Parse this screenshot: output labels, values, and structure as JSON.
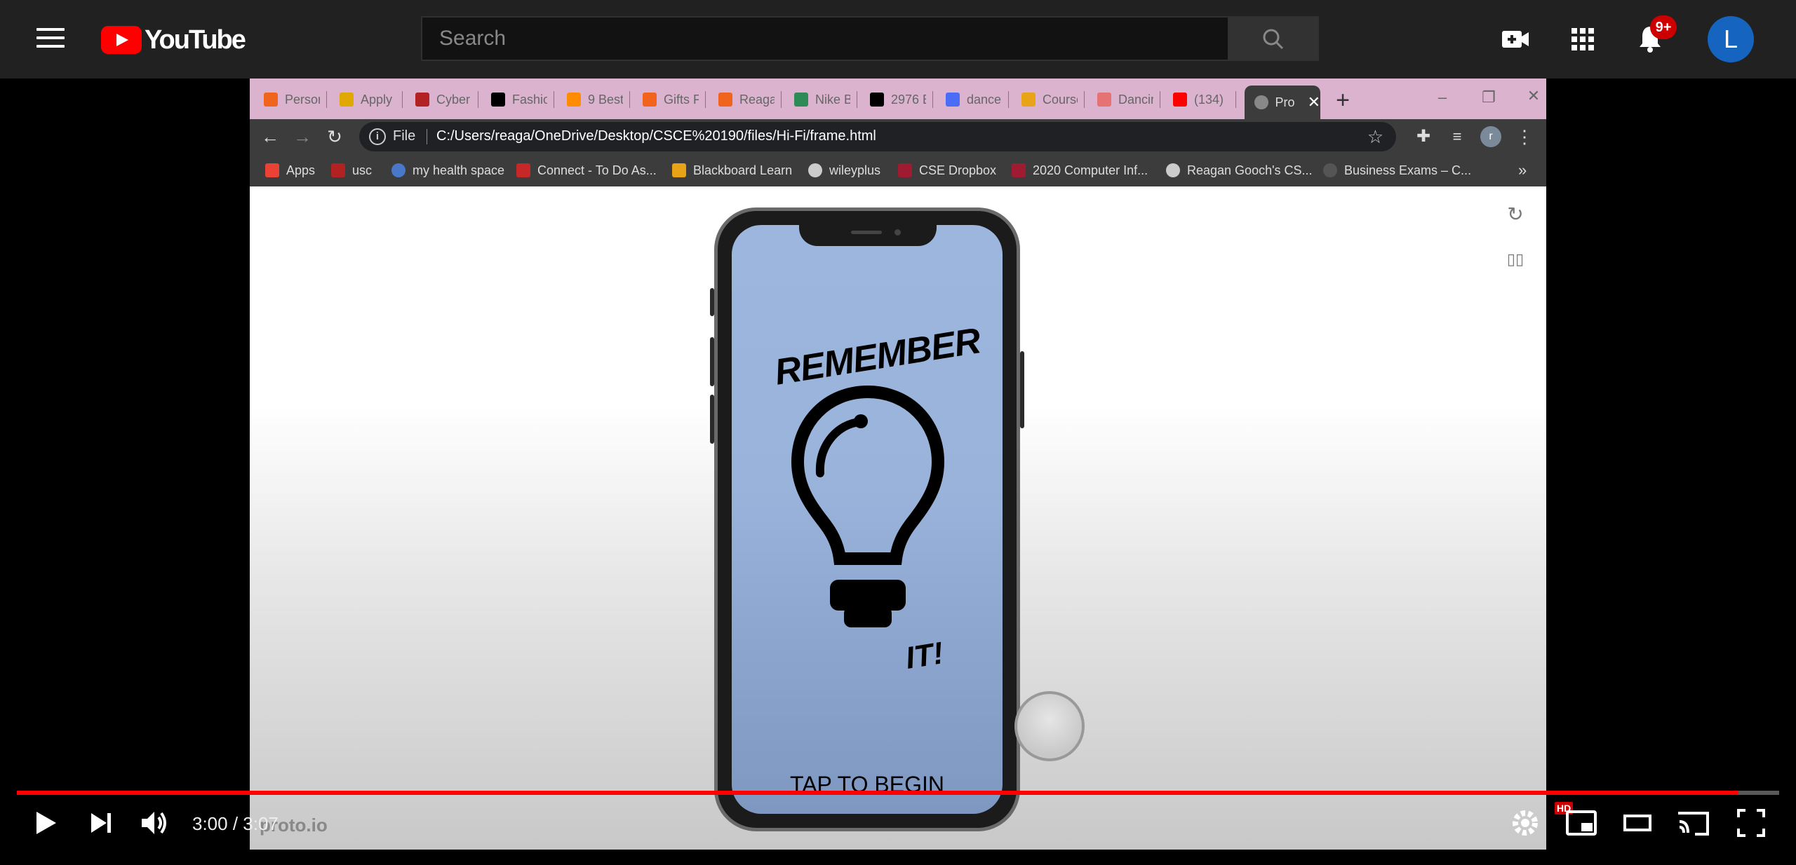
{
  "masthead": {
    "logo_text": "YouTube",
    "search_placeholder": "Search",
    "notification_count": "9+",
    "avatar_letter": "L"
  },
  "browser": {
    "tabs": [
      {
        "title": "Person",
        "favicon": "etsy-icon",
        "color": "#f1641e"
      },
      {
        "title": "Apply",
        "favicon": "coin-icon",
        "color": "#e0a800"
      },
      {
        "title": "Cyber",
        "favicon": "flag-icon",
        "color": "#b22222"
      },
      {
        "title": "Fashio",
        "favicon": "brand-icon",
        "color": "#000000"
      },
      {
        "title": "9 Best",
        "favicon": "star-icon",
        "color": "#ff8c00"
      },
      {
        "title": "Gifts F",
        "favicon": "etsy-icon",
        "color": "#f1641e"
      },
      {
        "title": "Reaga",
        "favicon": "etsy-icon",
        "color": "#f1641e"
      },
      {
        "title": "Nike B",
        "favicon": "x-icon",
        "color": "#2e8b57"
      },
      {
        "title": "2976 B",
        "favicon": "plus-icon",
        "color": "#000000"
      },
      {
        "title": "dance",
        "favicon": "q-icon",
        "color": "#4a6cf7"
      },
      {
        "title": "Course",
        "favicon": "pencil-icon",
        "color": "#e8a317"
      },
      {
        "title": "Dancir",
        "favicon": "dance-icon",
        "color": "#e57373"
      },
      {
        "title": "(134)",
        "favicon": "youtube-icon",
        "color": "#ff0000"
      }
    ],
    "active_tab": {
      "title": "Pro",
      "close": "✕"
    },
    "new_tab": "+",
    "address": {
      "scheme_label": "File",
      "url": "C:/Users/reaga/OneDrive/Desktop/CSCE%20190/files/Hi-Fi/frame.html"
    },
    "bookmarks": [
      {
        "label": "Apps",
        "icon": "apps-grid-icon",
        "color": "#ea4335"
      },
      {
        "label": "usc",
        "icon": "flag-icon",
        "color": "#b22222"
      },
      {
        "label": "my health space",
        "icon": "globe-icon",
        "color": "#4a78c8"
      },
      {
        "label": "Connect - To Do As...",
        "icon": "connect-icon",
        "color": "#c62828"
      },
      {
        "label": "Blackboard Learn",
        "icon": "pencil-icon",
        "color": "#e8a317"
      },
      {
        "label": "wileyplus",
        "icon": "globe-icon",
        "color": "#cccccc"
      },
      {
        "label": "CSE Dropbox",
        "icon": "usc-icon",
        "color": "#9e1b32"
      },
      {
        "label": "2020 Computer Inf...",
        "icon": "usc-icon",
        "color": "#9e1b32"
      },
      {
        "label": "Reagan Gooch's CS...",
        "icon": "globe-icon",
        "color": "#cccccc"
      },
      {
        "label": "Business Exams – C...",
        "icon": "shield-icon",
        "color": "#555555"
      }
    ],
    "bookmarks_more": "»"
  },
  "prototype": {
    "title_top": "REMEMBER",
    "title_bottom": "IT!",
    "cta": "TAP TO BEGIN",
    "brand": "proto.io"
  },
  "player": {
    "time": "3:00 / 3:07",
    "progress": 0.977,
    "hd_label": "HD"
  },
  "colors": {
    "youtube_red": "#ff0000",
    "masthead_bg": "#212121",
    "tabstrip_bg": "#dbb3cf",
    "phone_screen": "#9cb6dd"
  }
}
